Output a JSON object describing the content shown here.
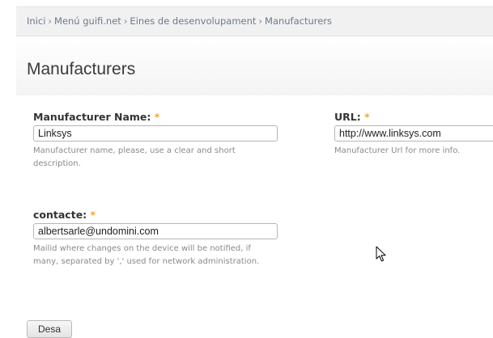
{
  "breadcrumb": {
    "items": [
      "Inici",
      "Menú guifi.net",
      "Eines de desenvolupament",
      "Manufacturers"
    ],
    "separator": "›"
  },
  "page": {
    "title": "Manufacturers"
  },
  "form": {
    "name": {
      "label": "Manufacturer Name:",
      "required_marker": "*",
      "value": "Linksys",
      "description_line1": "Manufacturer name, please, use a clear and short",
      "description_line2": "description."
    },
    "url": {
      "label": "URL:",
      "required_marker": "*",
      "value": "http://www.linksys.com",
      "description": "Manufacturer Url for more info."
    },
    "contact": {
      "label": "contacte:",
      "required_marker": "*",
      "value": "albertsarle@undomini.com",
      "description_line1": "Mailid where changes on the device will be notified, if",
      "description_line2": "many, separated by ',' used for network administration."
    },
    "save_label": "Desa"
  },
  "colors": {
    "required": "#f5a623",
    "breadcrumb_bg": "#f1f1f1"
  },
  "icons": {
    "cursor": "mouse-pointer-icon"
  }
}
